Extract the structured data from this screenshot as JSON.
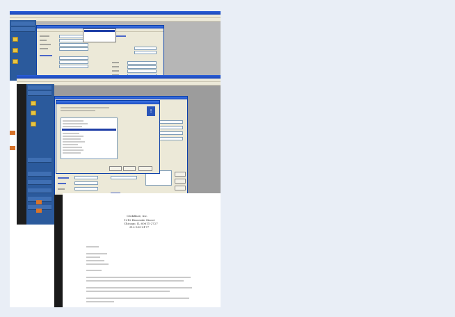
{
  "letter": {
    "company_name": "ClickBase, Inc.",
    "address_line1": "1210 Riverside Street",
    "address_line2": "Chicago, IL 60611-2727",
    "phone": "312-555-0177"
  },
  "colors": {
    "page_background": "#e9eef6",
    "xp_title_blue": "#1f4fc2",
    "nav_panel_blue": "#2b5a9c",
    "folder_yellow": "#e8c542",
    "accent_orange": "#d9742a"
  }
}
